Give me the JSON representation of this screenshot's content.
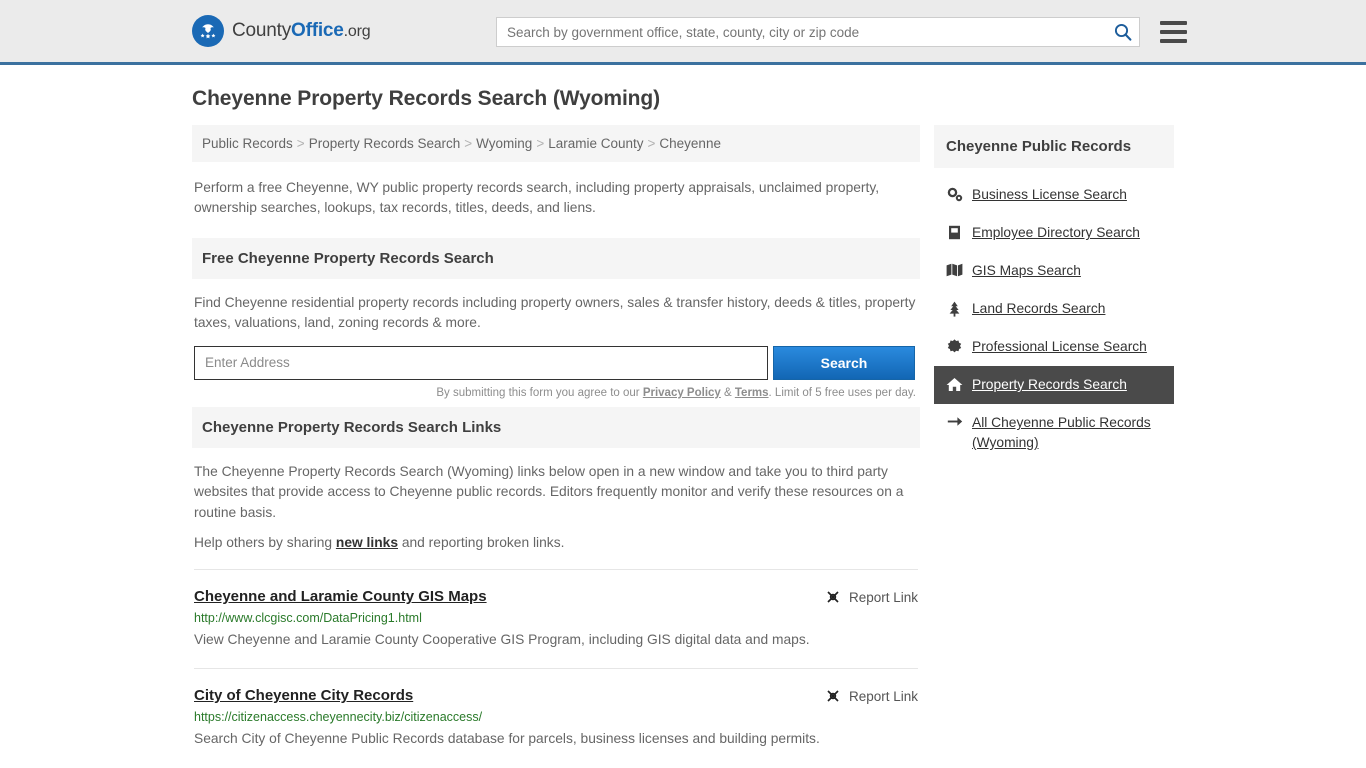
{
  "header": {
    "logo": {
      "part1": "County",
      "part2": "Office",
      "part3": ".org",
      "icon": "eagle-seal-icon"
    },
    "search_placeholder": "Search by government office, state, county, city or zip code",
    "search_value": "",
    "search_icon": "search-icon",
    "menu_icon": "hamburger-menu-icon"
  },
  "page_title": "Cheyenne Property Records Search (Wyoming)",
  "breadcrumb": {
    "separator": ">",
    "items": [
      {
        "label": "Public Records"
      },
      {
        "label": "Property Records Search"
      },
      {
        "label": "Wyoming"
      },
      {
        "label": "Laramie County"
      },
      {
        "label": "Cheyenne"
      }
    ]
  },
  "intro": "Perform a free Cheyenne, WY public property records search, including property appraisals, unclaimed property, ownership searches, lookups, tax records, titles, deeds, and liens.",
  "free_search": {
    "heading": "Free Cheyenne Property Records Search",
    "description": "Find Cheyenne residential property records including property owners, sales & transfer history, deeds & titles, property taxes, valuations, land, zoning records & more.",
    "input_placeholder": "Enter Address",
    "input_value": "",
    "button_label": "Search",
    "disclaimer_pre": "By submitting this form you agree to our ",
    "disclaimer_privacy": "Privacy Policy",
    "disclaimer_amp": " & ",
    "disclaimer_terms": "Terms",
    "disclaimer_post": ". Limit of 5 free uses per day."
  },
  "links_section": {
    "heading": "Cheyenne Property Records Search Links",
    "paragraph": "The Cheyenne Property Records Search (Wyoming) links below open in a new window and take you to third party websites that provide access to Cheyenne public records. Editors frequently monitor and verify these resources on a routine basis.",
    "help_pre": "Help others by sharing ",
    "help_link": "new links",
    "help_post": " and reporting broken links.",
    "report_label": "Report Link",
    "report_icon": "unlink-icon",
    "items": [
      {
        "title": "Cheyenne and Laramie County GIS Maps",
        "url": "http://www.clcgisc.com/DataPricing1.html",
        "description": "View Cheyenne and Laramie County Cooperative GIS Program, including GIS digital data and maps."
      },
      {
        "title": "City of Cheyenne City Records",
        "url": "https://citizenaccess.cheyennecity.biz/citizenaccess/",
        "description": "Search City of Cheyenne Public Records database for parcels, business licenses and building permits."
      }
    ]
  },
  "sidebar": {
    "heading": "Cheyenne Public Records",
    "items": [
      {
        "label": "Business License Search",
        "icon": "cogs-icon",
        "active": false
      },
      {
        "label": "Employee Directory Search",
        "icon": "book-icon",
        "active": false
      },
      {
        "label": "GIS Maps Search",
        "icon": "map-icon",
        "active": false
      },
      {
        "label": "Land Records Search",
        "icon": "tree-icon",
        "active": false
      },
      {
        "label": "Professional License Search",
        "icon": "certificate-icon",
        "active": false
      },
      {
        "label": "Property Records Search",
        "icon": "home-icon",
        "active": true
      },
      {
        "label": "All Cheyenne Public Records (Wyoming)",
        "icon": "arrow-right-icon",
        "active": false
      }
    ]
  },
  "colors": {
    "header_bg": "#ebebeb",
    "header_border": "#3b719f",
    "brand_blue": "#1a69b5",
    "button_blue": "#1266b4",
    "active_item_bg": "#4a4a4a",
    "url_green": "#2a7a2a",
    "panel_gray": "#f5f5f5"
  }
}
